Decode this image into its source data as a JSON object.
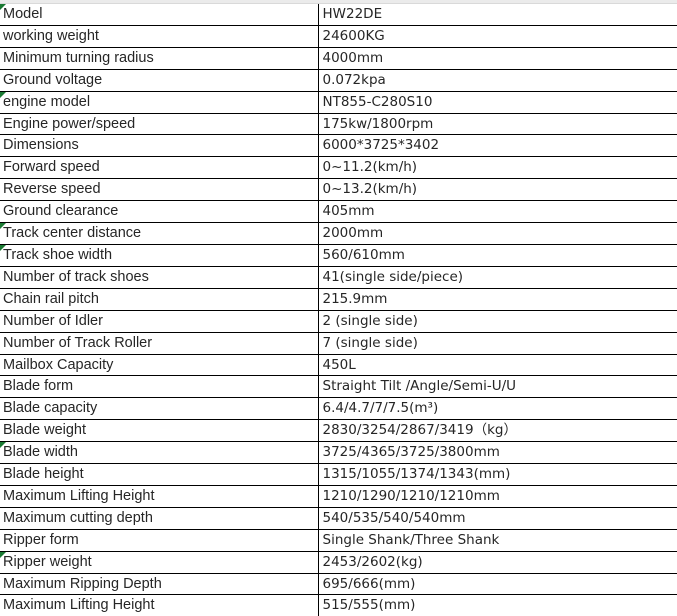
{
  "document": {
    "kind": "spreadsheet-spec-table",
    "colors": {
      "grid_line": "#000000",
      "text": "#262626",
      "comment_flag_green": "#1a7a32",
      "top_strip_grey": "#ebebeb",
      "background": "#ffffff"
    }
  },
  "table": {
    "columns": [
      {
        "key": "label",
        "header": ""
      },
      {
        "key": "value",
        "header": ""
      }
    ],
    "rows": [
      {
        "label": "Model",
        "value": "HW22DE",
        "flag": true
      },
      {
        "label": "working weight",
        "value": "24600KG",
        "flag": false
      },
      {
        "label": "Minimum turning radius",
        "value": "4000mm",
        "flag": false
      },
      {
        "label": "Ground voltage",
        "value": "0.072kpa",
        "flag": false
      },
      {
        "label": "engine model",
        "value": "NT855-C280S10",
        "flag": true
      },
      {
        "label": "Engine power/speed",
        "value": "175kw/1800rpm",
        "flag": false
      },
      {
        "label": "Dimensions",
        "value": "6000*3725*3402",
        "flag": false
      },
      {
        "label": "Forward speed",
        "value": "0~11.2(km/h)",
        "flag": false
      },
      {
        "label": "Reverse speed",
        "value": "0~13.2(km/h)",
        "flag": false
      },
      {
        "label": "Ground clearance",
        "value": "405mm",
        "flag": false
      },
      {
        "label": "Track center distance",
        "value": "2000mm",
        "flag": true
      },
      {
        "label": "Track shoe width",
        "value": "560/610mm",
        "flag": true
      },
      {
        "label": "Number of track shoes",
        "value": "41(single side/piece)",
        "flag": false
      },
      {
        "label": "Chain rail pitch",
        "value": "215.9mm",
        "flag": false
      },
      {
        "label": "Number of Idler",
        "value": "2 (single side)",
        "flag": false
      },
      {
        "label": "Number of Track Roller",
        "value": "7 (single side)",
        "flag": false
      },
      {
        "label": "Mailbox Capacity",
        "value": "450L",
        "flag": false
      },
      {
        "label": "Blade form",
        "value": "Straight Tilt /Angle/Semi-U/U",
        "flag": false
      },
      {
        "label": "Blade capacity",
        "value": "6.4/4.7/7/7.5(m³)",
        "flag": false
      },
      {
        "label": "Blade weight",
        "value": "2830/3254/2867/3419（kg）",
        "flag": false
      },
      {
        "label": "Blade width",
        "value": "3725/4365/3725/3800mm",
        "flag": true
      },
      {
        "label": "Blade height",
        "value": "1315/1055/1374/1343(mm)",
        "flag": false
      },
      {
        "label": "Maximum Lifting Height",
        "value": "1210/1290/1210/1210mm",
        "flag": false
      },
      {
        "label": "Maximum cutting depth",
        "value": "540/535/540/540mm",
        "flag": false
      },
      {
        "label": "Ripper form",
        "value": "Single Shank/Three Shank",
        "flag": false
      },
      {
        "label": "Ripper weight",
        "value": "2453/2602(kg)",
        "flag": true
      },
      {
        "label": "Maximum Ripping Depth",
        "value": "695/666(mm)",
        "flag": false
      },
      {
        "label": "Maximum Lifting Height",
        "value": "515/555(mm)",
        "flag": false
      }
    ]
  }
}
